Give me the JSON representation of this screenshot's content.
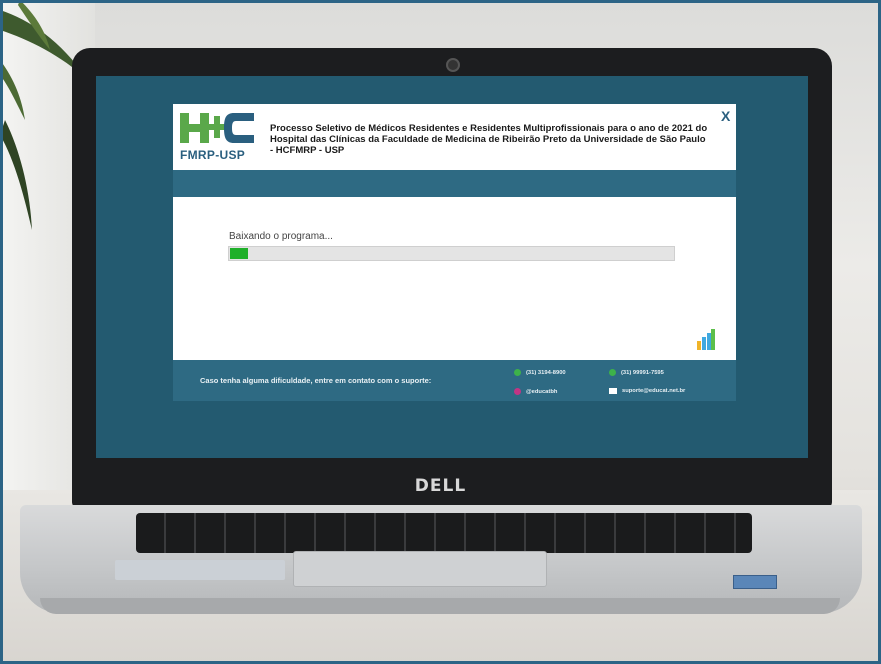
{
  "brand": {
    "laptop": "DELL"
  },
  "installer": {
    "logo": {
      "letters": "HC",
      "subtitle": "FMRP-USP"
    },
    "title": "Processo Seletivo de Médicos Residentes e Residentes Multiprofissionais para o ano de 2021 do Hospital das Clínicas da Faculdade de Medicina de Ribeirão Preto da Universidade de São Paulo - HCFMRP - USP",
    "close_label": "X",
    "status": "Baixando o programa...",
    "progress": 0.04,
    "footer": {
      "support_text": "Caso tenha alguma dificuldade, entre em contato com o suporte:",
      "contacts": [
        {
          "icon": "whatsapp-icon",
          "color": "#3db24a",
          "text": "(31) 3194-8900"
        },
        {
          "icon": "whatsapp-icon",
          "color": "#3db24a",
          "text": "(31) 99991-7595"
        },
        {
          "icon": "instagram-icon",
          "color": "#c13584",
          "text": "@educatbh"
        },
        {
          "icon": "mail-icon",
          "color": "#ffffff",
          "text": "suporte@educat.net.br"
        }
      ]
    }
  },
  "colors": {
    "screen": "#235a70",
    "band": "#2e6a83",
    "progress": "#1fb02a",
    "logo_green": "#5aa84a",
    "logo_blue": "#2a5f7f"
  }
}
